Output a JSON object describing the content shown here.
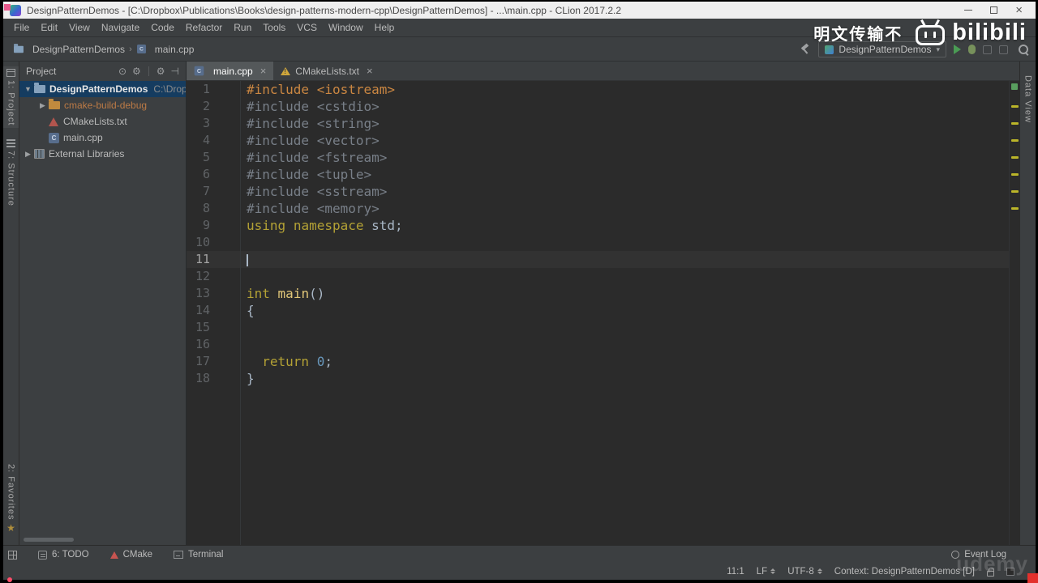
{
  "titlebar": {
    "title": "DesignPatternDemos - [C:\\Dropbox\\Publications\\Books\\design-patterns-modern-cpp\\DesignPatternDemos] - ...\\main.cpp - CLion 2017.2.2"
  },
  "menu": {
    "items": [
      "File",
      "Edit",
      "View",
      "Navigate",
      "Code",
      "Refactor",
      "Run",
      "Tools",
      "VCS",
      "Window",
      "Help"
    ]
  },
  "navbar": {
    "breadcrumbs": [
      {
        "label": "DesignPatternDemos"
      },
      {
        "label": "main.cpp"
      }
    ],
    "separator": "›",
    "run_config": "DesignPatternDemos",
    "combo_arrow": "▾"
  },
  "watermarks": {
    "bilibili_text": "明文传输不",
    "bilibili_logo": "bilibili",
    "udemy": "udemy"
  },
  "left_stripe": {
    "project": "1: Project",
    "structure": "7: Structure",
    "favorites": "2: Favorites",
    "star": "★"
  },
  "right_stripe": {
    "data_view": "Data View"
  },
  "project_panel": {
    "header": "Project",
    "icons": {
      "locate": "⊙",
      "gear": "⚙",
      "settings": "⚙",
      "hide": "⊣"
    },
    "chevron_down": "▼",
    "chevron_right": "▶",
    "tree": [
      {
        "label": "DesignPatternDemos",
        "suffix": "C:\\Drop"
      },
      {
        "label": "cmake-build-debug"
      },
      {
        "label": "CMakeLists.txt"
      },
      {
        "label": "main.cpp"
      },
      {
        "label": "External Libraries"
      }
    ]
  },
  "editor": {
    "tabs": [
      {
        "label": "main.cpp"
      },
      {
        "label": "CMakeLists.txt"
      }
    ],
    "tab_close": "×",
    "cursor_line": 11,
    "warning_lines": [
      2,
      3,
      4,
      5,
      6,
      7,
      8
    ],
    "lines": [
      {
        "n": 1,
        "tokens": [
          {
            "t": "#include <iostream>",
            "c": "inc"
          }
        ]
      },
      {
        "n": 2,
        "tokens": [
          {
            "t": "#include <cstdio>",
            "c": "dim"
          }
        ]
      },
      {
        "n": 3,
        "tokens": [
          {
            "t": "#include <string>",
            "c": "dim"
          }
        ]
      },
      {
        "n": 4,
        "tokens": [
          {
            "t": "#include <vector>",
            "c": "dim"
          }
        ]
      },
      {
        "n": 5,
        "tokens": [
          {
            "t": "#include <fstream>",
            "c": "dim"
          }
        ]
      },
      {
        "n": 6,
        "tokens": [
          {
            "t": "#include <tuple>",
            "c": "dim"
          }
        ]
      },
      {
        "n": 7,
        "tokens": [
          {
            "t": "#include <sstream>",
            "c": "dim"
          }
        ]
      },
      {
        "n": 8,
        "tokens": [
          {
            "t": "#include <memory>",
            "c": "dim"
          }
        ]
      },
      {
        "n": 9,
        "tokens": [
          {
            "t": "using",
            "c": "kw"
          },
          {
            "t": " ",
            "c": "pl"
          },
          {
            "t": "namespace",
            "c": "kw"
          },
          {
            "t": " std;",
            "c": "pl"
          }
        ]
      },
      {
        "n": 10,
        "tokens": []
      },
      {
        "n": 11,
        "tokens": []
      },
      {
        "n": 12,
        "tokens": []
      },
      {
        "n": 13,
        "tokens": [
          {
            "t": "int",
            "c": "kw"
          },
          {
            "t": " ",
            "c": "pl"
          },
          {
            "t": "main",
            "c": "fn"
          },
          {
            "t": "()",
            "c": "pl"
          }
        ]
      },
      {
        "n": 14,
        "tokens": [
          {
            "t": "{",
            "c": "pl"
          }
        ]
      },
      {
        "n": 15,
        "tokens": []
      },
      {
        "n": 16,
        "tokens": []
      },
      {
        "n": 17,
        "tokens": [
          {
            "t": "  ",
            "c": "pl"
          },
          {
            "t": "return",
            "c": "kw"
          },
          {
            "t": " ",
            "c": "pl"
          },
          {
            "t": "0",
            "c": "num"
          },
          {
            "t": ";",
            "c": "pl"
          }
        ]
      },
      {
        "n": 18,
        "tokens": [
          {
            "t": "}",
            "c": "pl"
          }
        ]
      }
    ]
  },
  "bottom_bar": {
    "todo": "6: TODO",
    "cmake": "CMake",
    "terminal": "Terminal",
    "event_log": "Event Log"
  },
  "status_bar": {
    "position": "11:1",
    "line_sep": "LF",
    "encoding": "UTF-8",
    "context": "Context: DesignPatternDemos [D]"
  }
}
